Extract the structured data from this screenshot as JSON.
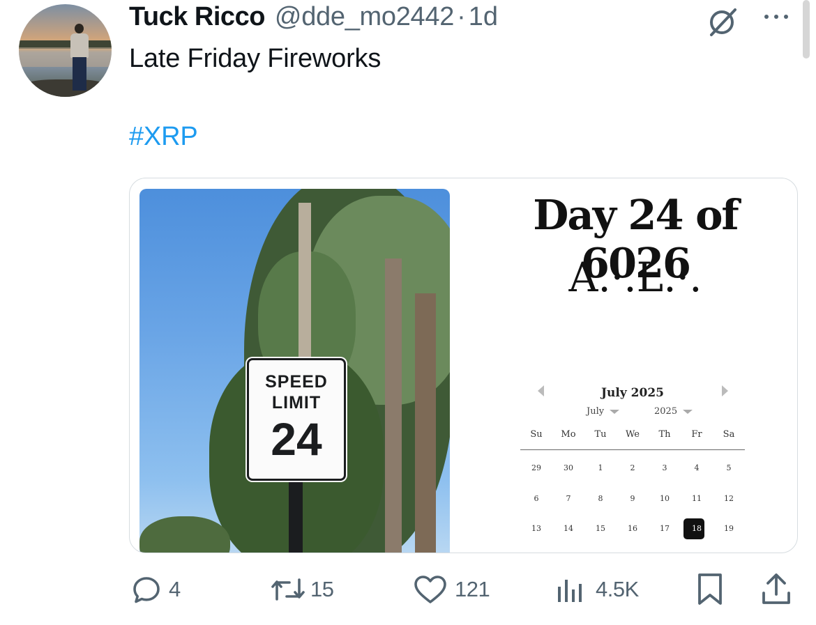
{
  "user": {
    "name": "Tuck Ricco",
    "handle": "@dde_mo2442",
    "separator": "·",
    "time": "1d"
  },
  "post": {
    "text_line1": "Late Friday Fireworks",
    "hashtag": "#XRP"
  },
  "media": {
    "sign": {
      "line1": "SPEED",
      "line2": "LIMIT",
      "number": "24"
    },
    "day_title": "Day 24 of 6026",
    "subtitle": "A.·.L.·.",
    "calendar": {
      "title": "July 2025",
      "month_select": "July",
      "year_select": "2025",
      "weekdays": [
        "Su",
        "Mo",
        "Tu",
        "We",
        "Th",
        "Fr",
        "Sa"
      ],
      "weeks": [
        [
          "29",
          "30",
          "1",
          "2",
          "3",
          "4",
          "5"
        ],
        [
          "6",
          "7",
          "8",
          "9",
          "10",
          "11",
          "12"
        ],
        [
          "13",
          "14",
          "15",
          "16",
          "17",
          "18",
          "19"
        ]
      ],
      "selected_day": "18"
    }
  },
  "actions": {
    "replies": "4",
    "reposts": "15",
    "likes": "121",
    "views": "4.5K"
  },
  "icons": {
    "reply": "reply-icon",
    "repost": "repost-icon",
    "like": "like-icon",
    "views": "views-icon",
    "bookmark": "bookmark-icon",
    "share": "share-icon",
    "grok": "grok-icon",
    "more": "more-icon"
  },
  "colors": {
    "text": "#0f1419",
    "secondary": "#536471",
    "link": "#1d9bf0"
  }
}
